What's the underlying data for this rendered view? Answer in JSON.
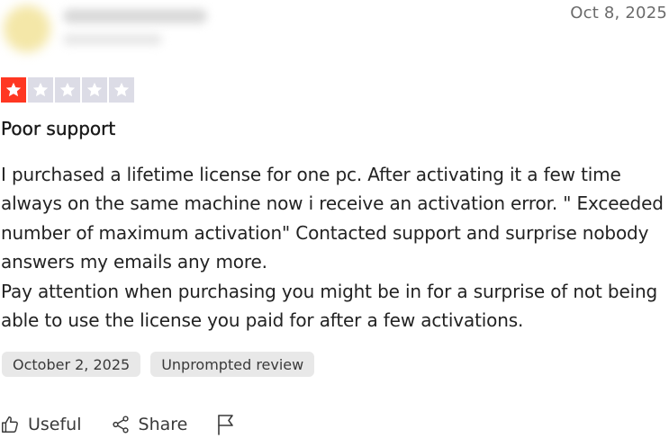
{
  "review": {
    "date_short": "Oct 8, 2025",
    "rating": 1,
    "max_rating": 5,
    "title": "Poor support",
    "body_paragraphs": [
      "I purchased a lifetime license for one pc. After activating it a few time always on the same machine now i receive an activation error. \" Exceeded number of maximum activation\" Contacted support and surprise nobody answers my emails any more.",
      "Pay attention when purchasing you might be in for a surprise of not being able to use the license you paid for after a few activations."
    ],
    "experience_date": "October 2, 2025",
    "review_type": "Unprompted review"
  },
  "actions": {
    "useful_label": "Useful",
    "share_label": "Share"
  },
  "colors": {
    "star_filled": "#ff3722",
    "star_empty": "#dcdce6",
    "chip_bg": "#e8e8e8"
  },
  "icons": {
    "useful": "thumbs-up-icon",
    "share": "share-icon",
    "report": "flag-icon",
    "star": "star-icon"
  }
}
